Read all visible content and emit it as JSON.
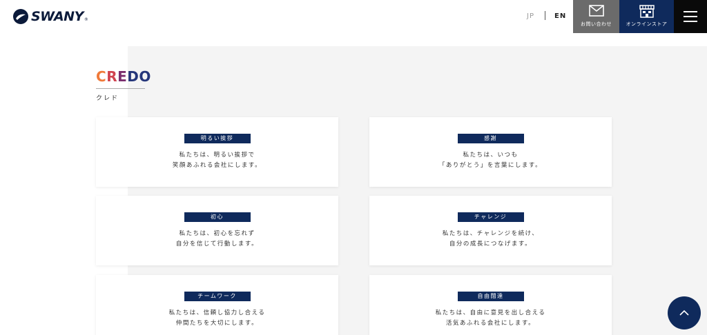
{
  "header": {
    "logo_text": "SWANY",
    "logo_reg": "®",
    "lang_jp": "JP",
    "lang_en": "EN",
    "contact_label": "お問い合わせ",
    "store_label": "オンラインストア"
  },
  "section": {
    "title_parts": [
      "C",
      "R",
      "E",
      "DO"
    ],
    "subtitle": "クレド"
  },
  "cards": [
    {
      "tag": "明るい挨拶",
      "line1": "私たちは、明るい挨拶で",
      "line2": "笑顔あふれる会社にします。"
    },
    {
      "tag": "感謝",
      "line1": "私たちは、いつも",
      "line2": "「ありがとう」を言葉にします。"
    },
    {
      "tag": "初心",
      "line1": "私たちは、初心を忘れず",
      "line2": "自分を信じて行動します。"
    },
    {
      "tag": "チャレンジ",
      "line1": "私たちは、チャレンジを続け、",
      "line2": "自分の成長につなげます。"
    },
    {
      "tag": "チームワーク",
      "line1": "私たちは、信頼し協力し合える",
      "line2": "仲間たちを大切にします。"
    },
    {
      "tag": "自由闊達",
      "line1": "私たちは、自由に意見を出し合える",
      "line2": "活気あふれる会社にします。"
    }
  ],
  "colors": {
    "navy": "#0f2a5c",
    "contact_bg": "#6b6b6b",
    "menu_bg": "#0a0a0a",
    "panel_bg": "#f4f4f4"
  },
  "icons": {
    "contact": "mail-icon",
    "store": "store-icon",
    "menu": "hamburger-menu-icon",
    "scroll_top": "chevron-up-icon"
  }
}
